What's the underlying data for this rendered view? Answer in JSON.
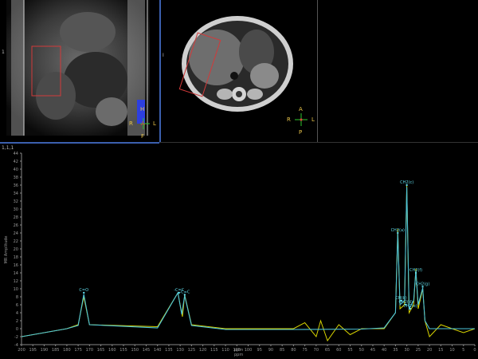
{
  "viewports": {
    "coronal": {
      "orientation": {
        "top": "H",
        "left": "R",
        "right": "L",
        "center": "A",
        "bottom": "F"
      },
      "left_tick": "1"
    },
    "axial": {
      "orientation": {
        "top": "A",
        "left": "R",
        "right": "L",
        "bottom": "P"
      },
      "left_tick": "I"
    }
  },
  "spectrum": {
    "corner_label": "1,1,1",
    "y_axis_label": "MR Amplitude",
    "x_axis_label": "ppm",
    "x_axis_label_2": "ppm",
    "colors": {
      "measured": "#d8d400",
      "fit": "#4cc3d9",
      "axis": "#888888",
      "background": "#000000"
    }
  },
  "chart_data": {
    "type": "line",
    "xlabel": "ppm",
    "ylabel": "MR Amplitude",
    "xlim": [
      200,
      0
    ],
    "ylim": [
      -4,
      44
    ],
    "x_ticks": [
      200,
      195,
      190,
      185,
      180,
      175,
      170,
      165,
      160,
      155,
      150,
      145,
      140,
      135,
      130,
      125,
      120,
      115,
      110,
      105,
      100,
      95,
      90,
      85,
      80,
      75,
      70,
      65,
      60,
      55,
      50,
      45,
      40,
      35,
      30,
      25,
      20,
      15,
      10,
      5,
      0
    ],
    "y_ticks": [
      -4,
      -2,
      0,
      2,
      4,
      6,
      8,
      10,
      12,
      14,
      16,
      18,
      20,
      22,
      24,
      26,
      28,
      30,
      32,
      34,
      36,
      38,
      40,
      42,
      44
    ],
    "peaks": [
      {
        "label": "C=O",
        "ppm": 172.5,
        "height": 9
      },
      {
        "label": "-C=C",
        "ppm": 130.5,
        "height": 9
      },
      {
        "label": "-C=C",
        "ppm": 128,
        "height": 8.5
      },
      {
        "label": "CH2(a)",
        "ppm": 34,
        "height": 24
      },
      {
        "label": "CH2(c)",
        "ppm": 30,
        "height": 36
      },
      {
        "label": "CH2(f)",
        "ppm": 26,
        "height": 14
      },
      {
        "label": "CH2(g)",
        "ppm": 23,
        "height": 10.5
      },
      {
        "label": "CH(b)",
        "ppm": 32.5,
        "height": 7
      },
      {
        "label": "CH2(d)",
        "ppm": 30.5,
        "height": 6
      },
      {
        "label": "CH2(e)",
        "ppm": 28.5,
        "height": 5
      }
    ],
    "series": [
      {
        "values": [
          [
            200,
            -2
          ],
          [
            180,
            0
          ],
          [
            175,
            1
          ],
          [
            172.5,
            8
          ],
          [
            170,
            1
          ],
          [
            140,
            0.5
          ],
          [
            131,
            9
          ],
          [
            129,
            3
          ],
          [
            128,
            8.5
          ],
          [
            125,
            1
          ],
          [
            110,
            0
          ],
          [
            80,
            0
          ],
          [
            75,
            1.5
          ],
          [
            70,
            -2
          ],
          [
            68,
            2
          ],
          [
            65,
            -3
          ],
          [
            60,
            1
          ],
          [
            55,
            -1.5
          ],
          [
            50,
            0
          ],
          [
            40,
            0
          ],
          [
            35,
            4
          ],
          [
            34,
            25
          ],
          [
            33,
            5
          ],
          [
            31,
            6
          ],
          [
            30,
            36
          ],
          [
            29,
            4
          ],
          [
            27,
            6
          ],
          [
            26,
            15
          ],
          [
            25,
            5
          ],
          [
            23,
            10
          ],
          [
            22,
            2
          ],
          [
            20,
            -2
          ],
          [
            15,
            1
          ],
          [
            10,
            0
          ],
          [
            5,
            -1
          ],
          [
            0,
            0
          ]
        ]
      },
      {
        "values": [
          [
            200,
            -2
          ],
          [
            180,
            0
          ],
          [
            175,
            0.8
          ],
          [
            172.5,
            8.6
          ],
          [
            170,
            1
          ],
          [
            140,
            0.2
          ],
          [
            131,
            9
          ],
          [
            129.3,
            3.6
          ],
          [
            128,
            8.3
          ],
          [
            125,
            0.8
          ],
          [
            110,
            -0.2
          ],
          [
            80,
            -0.2
          ],
          [
            50,
            -0.1
          ],
          [
            40,
            0.2
          ],
          [
            35,
            4
          ],
          [
            34,
            24
          ],
          [
            33,
            6
          ],
          [
            31,
            7
          ],
          [
            30,
            35.5
          ],
          [
            29,
            5
          ],
          [
            27,
            7
          ],
          [
            26,
            14.5
          ],
          [
            25,
            6
          ],
          [
            23,
            10.2
          ],
          [
            22,
            2
          ],
          [
            20,
            0
          ],
          [
            10,
            0
          ],
          [
            0,
            0
          ]
        ]
      }
    ]
  }
}
